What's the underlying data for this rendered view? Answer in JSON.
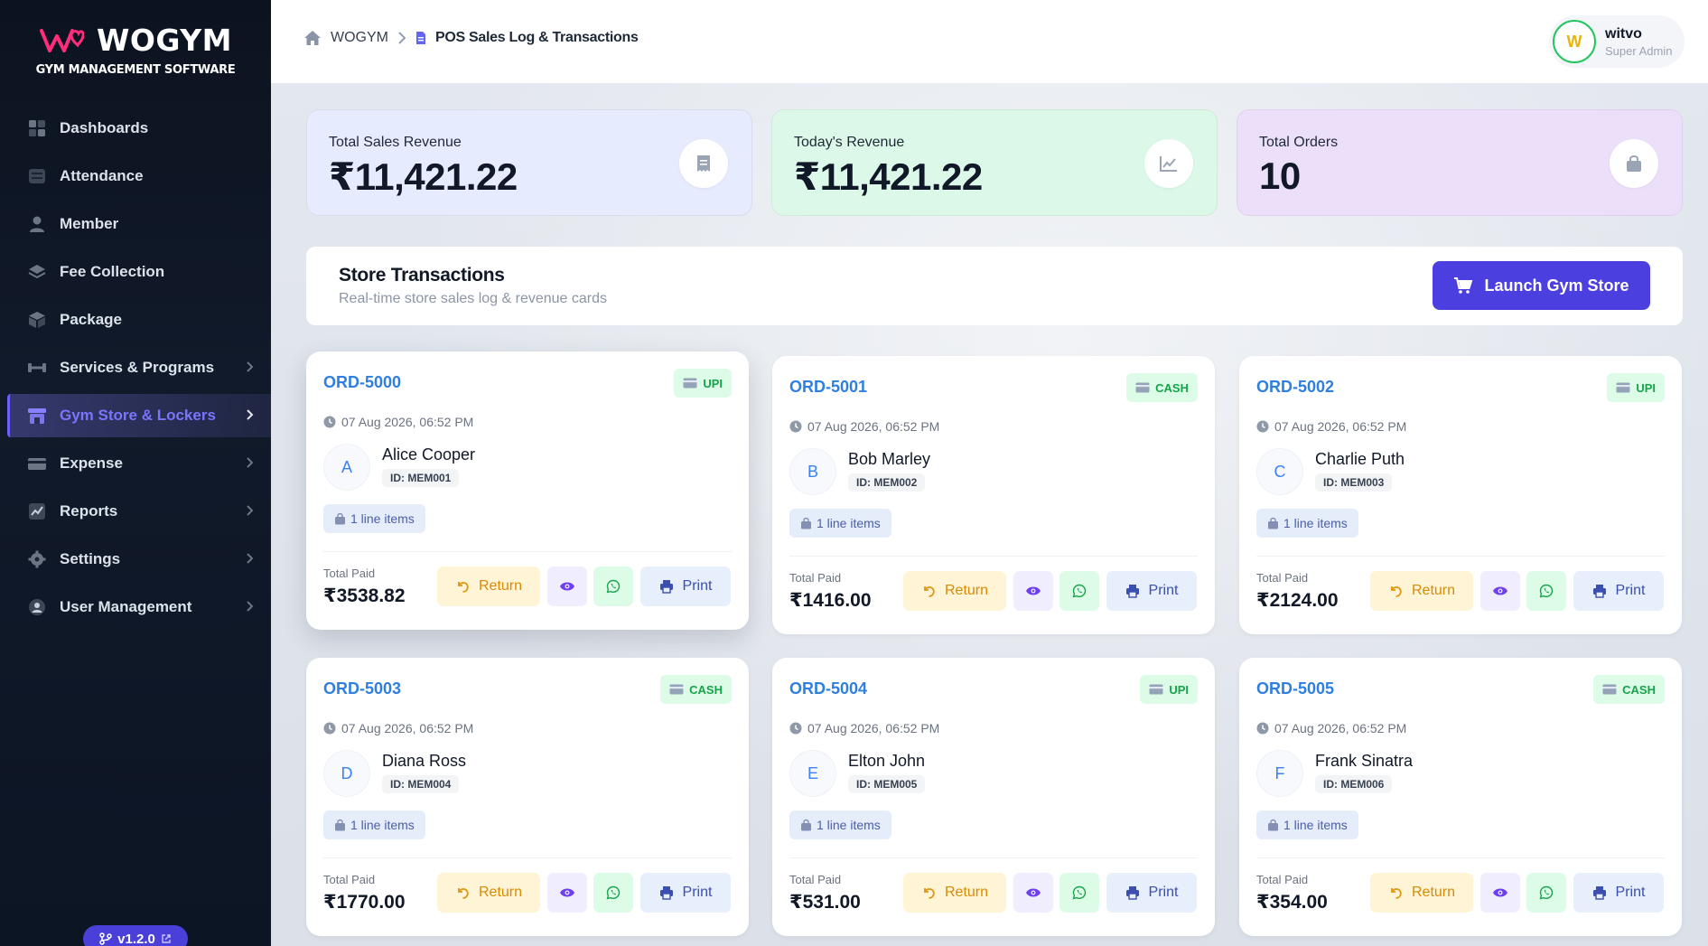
{
  "app": {
    "brand_name": "WOGYM",
    "brand_subtitle": "GYM MANAGEMENT SOFTWARE",
    "version": "v1.2.0"
  },
  "sidebar": {
    "items": [
      {
        "label": "Dashboards",
        "icon": "grid-icon",
        "has_chevron": false,
        "active": false
      },
      {
        "label": "Attendance",
        "icon": "list-icon",
        "has_chevron": false,
        "active": false
      },
      {
        "label": "Member",
        "icon": "person-icon",
        "has_chevron": false,
        "active": false
      },
      {
        "label": "Fee Collection",
        "icon": "stack-icon",
        "has_chevron": false,
        "active": false
      },
      {
        "label": "Package",
        "icon": "box-icon",
        "has_chevron": false,
        "active": false
      },
      {
        "label": "Services & Programs",
        "icon": "dumbbell-icon",
        "has_chevron": true,
        "active": false
      },
      {
        "label": "Gym Store & Lockers",
        "icon": "store-icon",
        "has_chevron": true,
        "active": true
      },
      {
        "label": "Expense",
        "icon": "card-icon",
        "has_chevron": true,
        "active": false
      },
      {
        "label": "Reports",
        "icon": "chart-icon",
        "has_chevron": true,
        "active": false
      },
      {
        "label": "Settings",
        "icon": "gear-icon",
        "has_chevron": true,
        "active": false
      },
      {
        "label": "User Management",
        "icon": "user-circle-icon",
        "has_chevron": true,
        "active": false
      }
    ]
  },
  "header": {
    "breadcrumb_root": "WOGYM",
    "breadcrumb_current": "POS Sales Log & Transactions",
    "user_initial": "W",
    "user_name": "witvo",
    "user_role": "Super Admin"
  },
  "stats": [
    {
      "label": "Total Sales Revenue",
      "value": "₹11,421.22",
      "icon": "receipt-icon",
      "bg": "#e6ebfd"
    },
    {
      "label": "Today's Revenue",
      "value": "₹11,421.22",
      "icon": "trend-icon",
      "bg": "#dcf8e8"
    },
    {
      "label": "Total Orders",
      "value": "10",
      "icon": "bag-icon",
      "bg": "#ecdffa"
    }
  ],
  "section": {
    "title": "Store Transactions",
    "subtitle": "Real-time store sales log & revenue cards",
    "launch_label": "Launch Gym Store"
  },
  "card_labels": {
    "total_paid": "Total Paid",
    "return": "Return",
    "print": "Print"
  },
  "orders": [
    {
      "id": "ORD-5000",
      "payment": "UPI",
      "date": "07 Aug 2026, 06:52 PM",
      "initial": "A",
      "name": "Alice Cooper",
      "member_id": "ID: MEM001",
      "items": "1 line items",
      "total": "₹3538.82"
    },
    {
      "id": "ORD-5001",
      "payment": "CASH",
      "date": "07 Aug 2026, 06:52 PM",
      "initial": "B",
      "name": "Bob Marley",
      "member_id": "ID: MEM002",
      "items": "1 line items",
      "total": "₹1416.00"
    },
    {
      "id": "ORD-5002",
      "payment": "UPI",
      "date": "07 Aug 2026, 06:52 PM",
      "initial": "C",
      "name": "Charlie Puth",
      "member_id": "ID: MEM003",
      "items": "1 line items",
      "total": "₹2124.00"
    },
    {
      "id": "ORD-5003",
      "payment": "CASH",
      "date": "07 Aug 2026, 06:52 PM",
      "initial": "D",
      "name": "Diana Ross",
      "member_id": "ID: MEM004",
      "items": "1 line items",
      "total": "₹1770.00"
    },
    {
      "id": "ORD-5004",
      "payment": "UPI",
      "date": "07 Aug 2026, 06:52 PM",
      "initial": "E",
      "name": "Elton John",
      "member_id": "ID: MEM005",
      "items": "1 line items",
      "total": "₹531.00"
    },
    {
      "id": "ORD-5005",
      "payment": "CASH",
      "date": "07 Aug 2026, 06:52 PM",
      "initial": "F",
      "name": "Frank Sinatra",
      "member_id": "ID: MEM006",
      "items": "1 line items",
      "total": "₹354.00"
    }
  ]
}
